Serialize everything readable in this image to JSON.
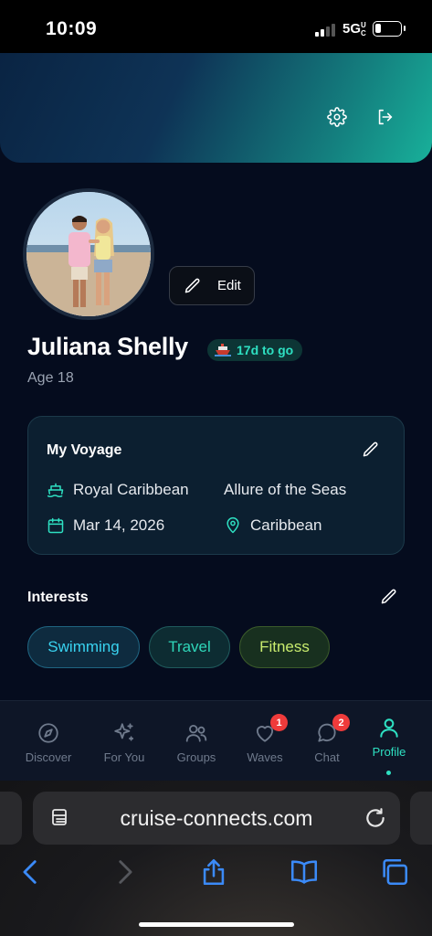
{
  "status_bar": {
    "time": "10:09",
    "network": "5G",
    "network_suffix": "UC"
  },
  "header": {
    "settings_icon": "gear-icon",
    "logout_icon": "logout-icon"
  },
  "profile": {
    "edit_label": "Edit",
    "name": "Juliana Shelly",
    "countdown": "17d to go",
    "age": "Age 18"
  },
  "voyage": {
    "title": "My Voyage",
    "cruise_line": "Royal Caribbean",
    "ship": "Allure of the Seas",
    "date": "Mar 14, 2026",
    "destination": "Caribbean"
  },
  "interests": {
    "title": "Interests",
    "items": [
      "Swimming",
      "Travel",
      "Fitness"
    ]
  },
  "nav": {
    "items": [
      {
        "label": "Discover",
        "icon": "compass-icon"
      },
      {
        "label": "For You",
        "icon": "sparkles-icon"
      },
      {
        "label": "Groups",
        "icon": "users-icon"
      },
      {
        "label": "Waves",
        "icon": "heart-icon",
        "badge": "1"
      },
      {
        "label": "Chat",
        "icon": "chat-icon",
        "badge": "2"
      },
      {
        "label": "Profile",
        "icon": "user-icon",
        "active": true
      }
    ]
  },
  "browser": {
    "url": "cruise-connects.com"
  },
  "colors": {
    "accent": "#2ee0c2",
    "background": "#050c1e",
    "badge": "#ef3b3b"
  }
}
